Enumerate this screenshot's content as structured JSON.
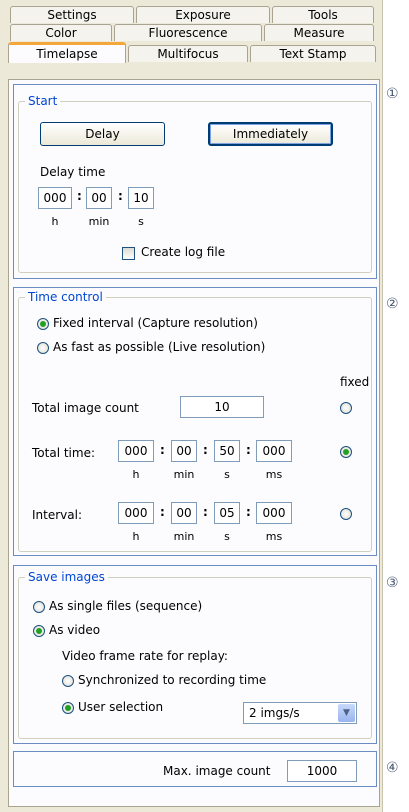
{
  "tabs": {
    "row1": [
      "Settings",
      "Exposure",
      "Tools"
    ],
    "row2": [
      "Color",
      "Fluorescence",
      "Measure"
    ],
    "row3": [
      "Timelapse",
      "Multifocus",
      "Text Stamp"
    ],
    "active": "Timelapse"
  },
  "markers": [
    "①",
    "②",
    "③",
    "④"
  ],
  "start": {
    "legend": "Start",
    "delay_button": "Delay",
    "immediately_button": "Immediately",
    "delay_time_label": "Delay time",
    "hours": "000",
    "minutes": "00",
    "seconds": "10",
    "unit_h": "h",
    "unit_min": "min",
    "unit_s": "s",
    "log_file_label": "Create log file",
    "log_file_checked": false
  },
  "time_control": {
    "legend": "Time control",
    "fixed_interval_label": "Fixed interval (Capture resolution)",
    "as_fast_label": "As fast as possible (Live resolution)",
    "mode_selected": "fixed_interval",
    "fixed_header": "fixed",
    "total_image_count_label": "Total image count",
    "total_image_count": "10",
    "total_time_label": "Total time:",
    "total_time": {
      "h": "000",
      "min": "00",
      "s": "50",
      "ms": "000"
    },
    "interval_label": "Interval:",
    "interval": {
      "h": "000",
      "min": "00",
      "s": "05",
      "ms": "000"
    },
    "unit_h": "h",
    "unit_min": "min",
    "unit_s": "s",
    "unit_ms": "ms",
    "fixed_selected": "total_time"
  },
  "save_images": {
    "legend": "Save images",
    "single_files_label": "As single files (sequence)",
    "video_label": "As video",
    "selected": "video",
    "frame_rate_label": "Video frame rate for replay:",
    "synchronized_label": "Synchronized to recording time",
    "user_selection_label": "User selection",
    "rate_selected": "user_selection",
    "rate_value": "2 imgs/s"
  },
  "max_count": {
    "label": "Max. image count",
    "value": "1000"
  }
}
